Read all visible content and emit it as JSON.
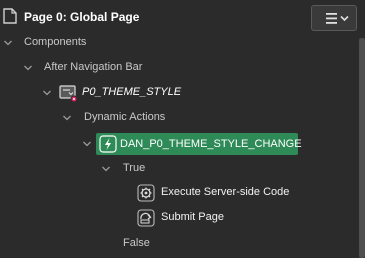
{
  "header": {
    "page_icon": "document-icon",
    "page_title": "Page 0: Global Page",
    "menu_button_icons": [
      "hamburger-icon",
      "chevron-down-icon"
    ]
  },
  "tree": {
    "components": "Components",
    "after_navigation_bar": "After Navigation Bar",
    "item": "P0_THEME_STYLE",
    "dynamic_actions": "Dynamic Actions",
    "dynamic_action": "DAN_P0_THEME_STYLE_CHANGE",
    "true_branch": "True",
    "action_1": "Execute Server-side Code",
    "action_2": "Submit Page",
    "false_branch": "False"
  },
  "colors": {
    "background": "#2b2b2b",
    "selected": "#2e8b57",
    "error_badge": "#e0245e"
  }
}
